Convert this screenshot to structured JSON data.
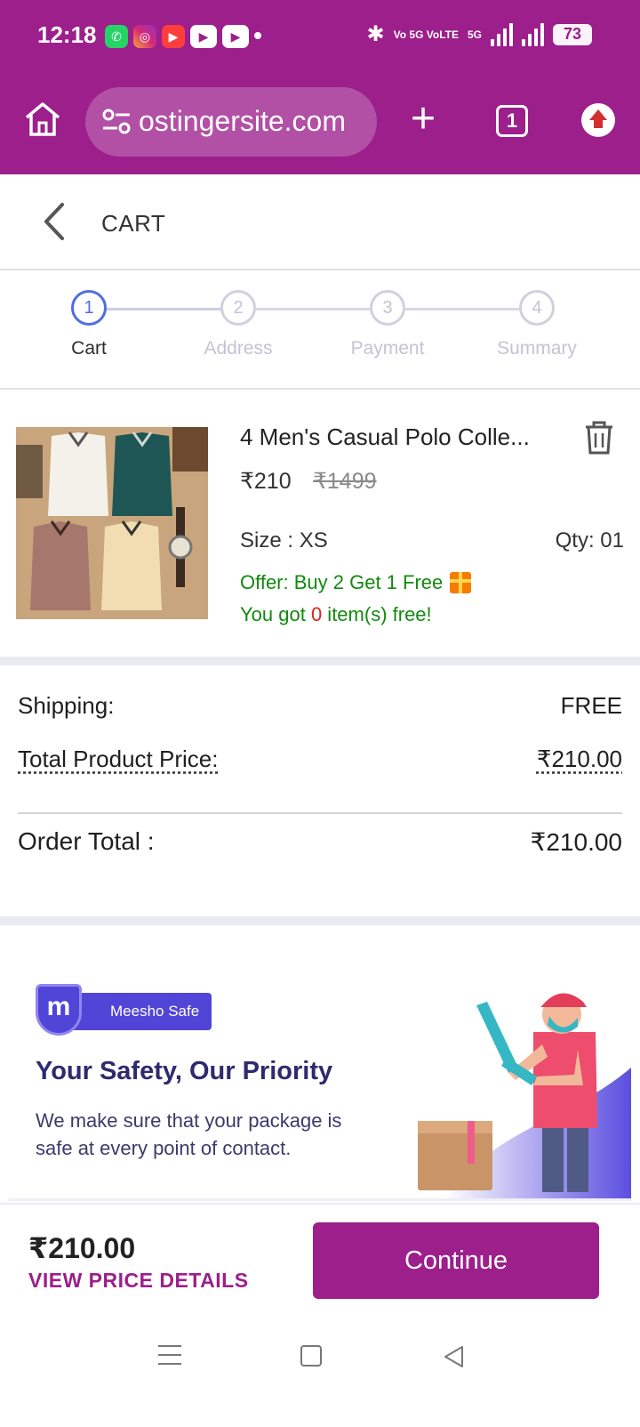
{
  "status_bar": {
    "time": "12:18",
    "network_label": "Vo 5G VoLTE",
    "signal_label": "5G",
    "battery": "73"
  },
  "browser": {
    "url": "ostingersite.com",
    "tab_count": "1"
  },
  "header": {
    "title": "CART"
  },
  "stepper": {
    "steps": [
      {
        "number": "1",
        "label": "Cart"
      },
      {
        "number": "2",
        "label": "Address"
      },
      {
        "number": "3",
        "label": "Payment"
      },
      {
        "number": "4",
        "label": "Summary"
      }
    ],
    "active_index": 0
  },
  "product": {
    "title": "4 Men's Casual Polo Colle...",
    "price": "₹210",
    "mrp": "₹1499",
    "size": "Size : XS",
    "qty": "Qty: 01",
    "offer": "Offer: Buy 2 Get 1 Free",
    "free_prefix": "You got ",
    "free_count": "0",
    "free_suffix": " item(s) free!"
  },
  "summary": {
    "shipping_label": "Shipping:",
    "shipping_value": "FREE",
    "product_price_label": "Total Product Price:",
    "product_price_value": "₹210.00",
    "order_total_label": "Order Total :",
    "order_total_value": "₹210.00"
  },
  "safe_banner": {
    "badge": "Meesho Safe",
    "badge_logo": "m",
    "title": "Your Safety, Our Priority",
    "text": "We make sure that your package is safe at every point of contact."
  },
  "bottom_bar": {
    "price": "₹210.00",
    "link": "VIEW PRICE DETAILS",
    "continue": "Continue"
  },
  "colors": {
    "brand": "#9c1f8b",
    "offer_green": "#118a0e",
    "step_active": "#4f6fe0",
    "safe_blue": "#5145d8"
  }
}
